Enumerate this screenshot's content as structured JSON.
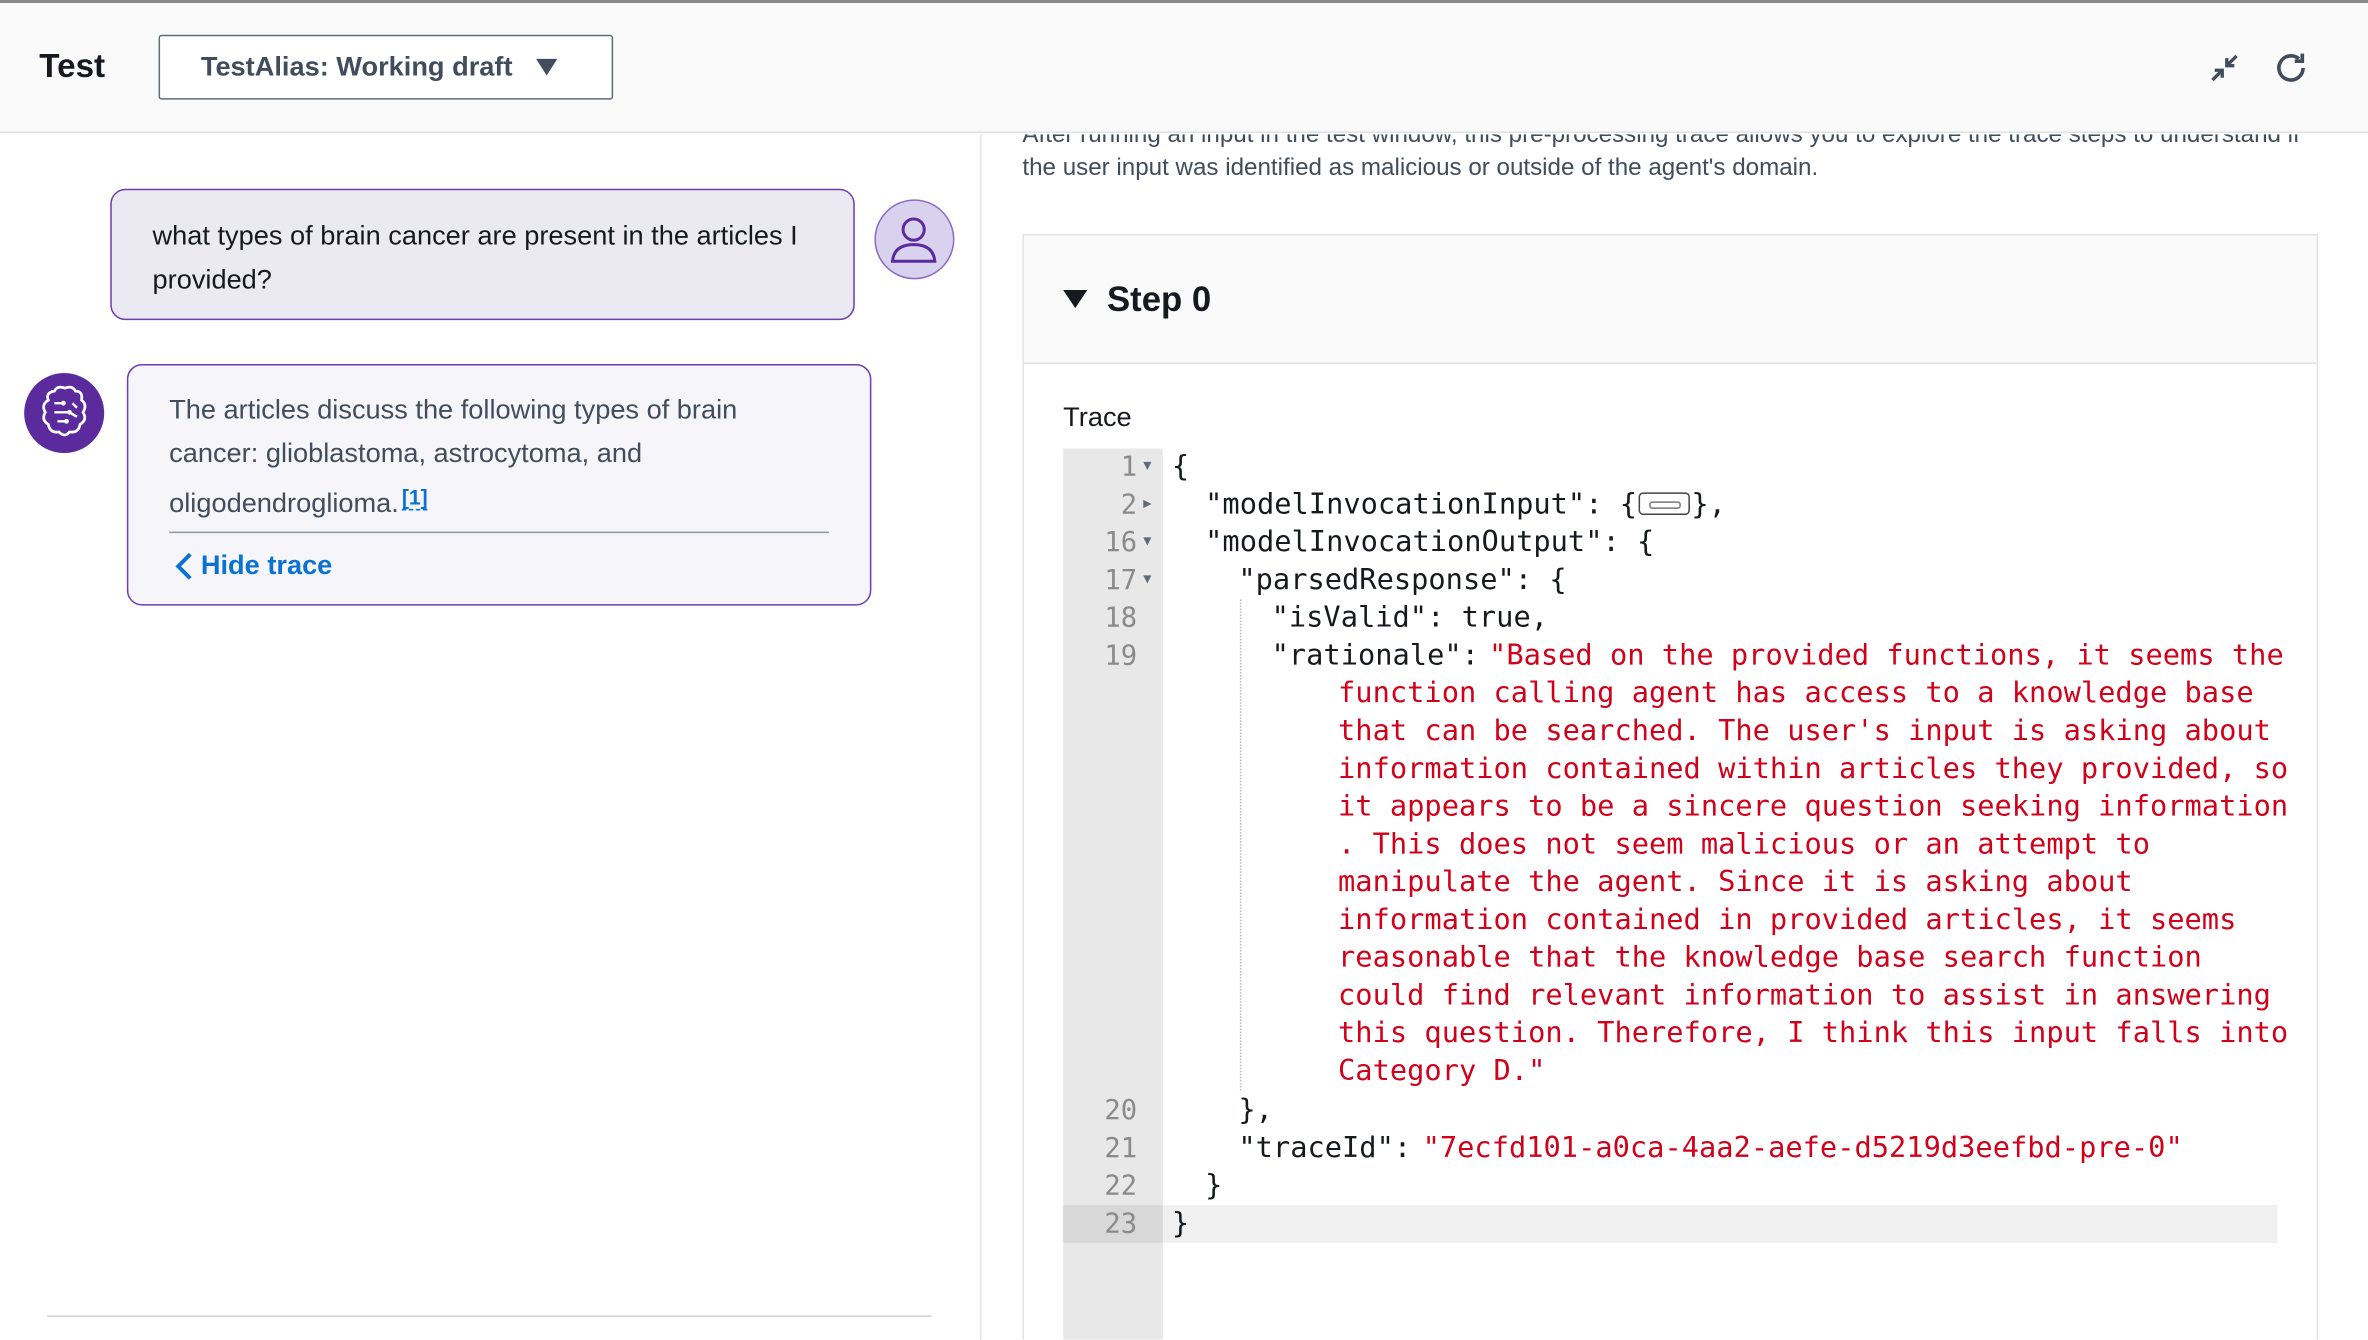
{
  "header": {
    "title": "Test",
    "alias_select": "TestAlias: Working draft",
    "icons": [
      "minimize-icon",
      "refresh-icon"
    ]
  },
  "chat": {
    "user_message": "what types of brain cancer are present in the articles I provided?",
    "agent_message": "The articles discuss the following types of brain cancer: glioblastoma, astrocytoma, and oligodendroglioma.",
    "citation": "[1]",
    "hide_trace": "Hide trace"
  },
  "trace_panel": {
    "description": "After running an input in the test window, this pre-processing trace allows you to explore the trace steps to understand if the user input was identified as malicious or outside of the agent's domain.",
    "step_title": "Step 0",
    "trace_label": "Trace",
    "code": {
      "line_numbers": [
        "1",
        "2",
        "16",
        "17",
        "18",
        "19",
        "20",
        "21",
        "22",
        "23"
      ],
      "l1": "{",
      "l2_key": "\"modelInvocationInput\": {",
      "l2_tail": "},",
      "l16": "\"modelInvocationOutput\": {",
      "l17": "\"parsedResponse\": {",
      "l18": "\"isValid\": true,",
      "l19_key": "\"rationale\": ",
      "rationale_lines": [
        "\"Based on the provided functions, it seems the",
        "function calling agent has access to a knowledge base",
        "that can be searched. The user's input is asking about",
        "information contained within articles they provided, so",
        "it appears to be a sincere question seeking information",
        ". This does not seem malicious or an attempt to",
        "manipulate the agent. Since it is asking about",
        "information contained in provided articles, it seems",
        "reasonable that the knowledge base search function",
        "could find relevant information to assist in answering",
        "this question. Therefore, I think this input falls into",
        "Category D.\""
      ],
      "l20": "},",
      "l21_key": "\"traceId\": ",
      "l21_val": "\"7ecfd101-a0ca-4aa2-aefe-d5219d3eefbd-pre-0\"",
      "l22": "}",
      "l23": "}"
    }
  }
}
